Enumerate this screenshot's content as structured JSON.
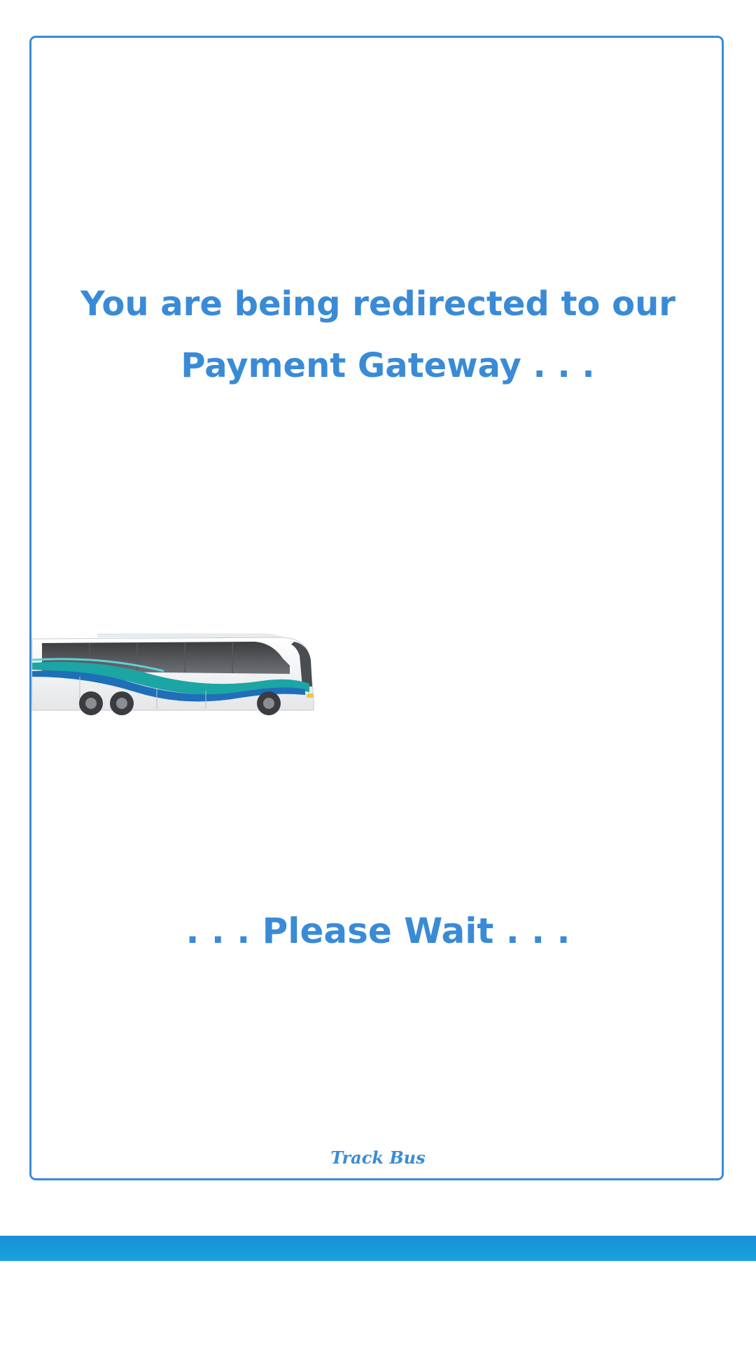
{
  "redirect": {
    "line1": "You are being redirected to our",
    "line2": "Payment Gateway . . ."
  },
  "wait_text": ". . . Please Wait . . .",
  "brand_text": "Track Bus",
  "bus_image": "bus-illustration",
  "colors": {
    "accent": "#3a8bd6",
    "bottom_bar": "#1a9ad9",
    "bus_stripe_blue": "#1f6fb8",
    "bus_stripe_teal": "#1ba5a5"
  }
}
